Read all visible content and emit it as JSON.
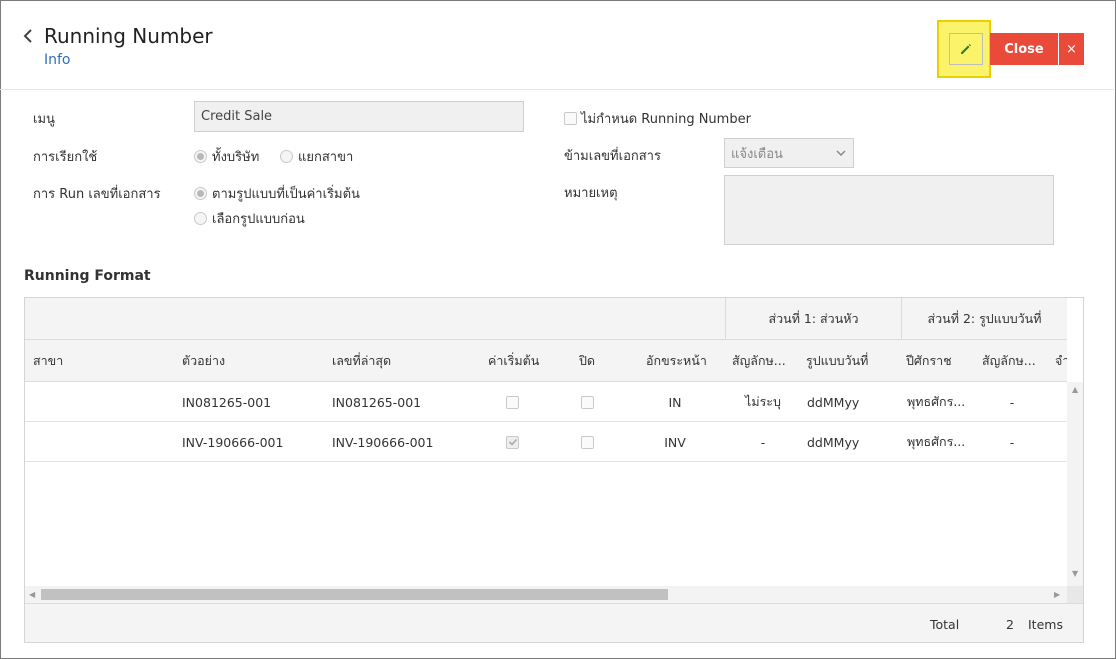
{
  "header": {
    "title": "Running Number",
    "subtitle": "Info",
    "close_label": "Close",
    "close_x": "×"
  },
  "form": {
    "menu_label": "เมนู",
    "menu_value": "Credit Sale",
    "usage_label": "การเรียกใช้",
    "usage_options": [
      "ทั้งบริษัท",
      "แยกสาขา"
    ],
    "run_label": "การ Run เลขที่เอกสาร",
    "run_options": [
      "ตามรูปแบบที่เป็นค่าเริ่มต้น",
      "เลือกรูปแบบก่อน"
    ],
    "no_running_label": "ไม่กำหนด Running Number",
    "skip_label": "ข้ามเลขที่เอกสาร",
    "skip_value": "แจ้งเตือน",
    "remark_label": "หมายเหตุ"
  },
  "section": {
    "title": "Running Format"
  },
  "grid": {
    "groups": [
      "ส่วนที่ 1: ส่วนหัว",
      "ส่วนที่ 2: รูปแบบวันที่"
    ],
    "columns": [
      "สาขา",
      "ตัวอย่าง",
      "เลขที่ล่าสุด",
      "ค่าเริ่มต้น",
      "ปิด",
      "อักขระหน้า",
      "สัญลักษ...",
      "รูปแบบวันที่",
      "ปีศักราช",
      "สัญลักษ...",
      "จำ"
    ],
    "rows": [
      {
        "branch": "",
        "example": "IN081265-001",
        "latest": "IN081265-001",
        "default": false,
        "closed": false,
        "prefix": "IN",
        "symbol1": "ไม่ระบุ",
        "date_format": "ddMMyy",
        "era": "พุทธศักร...",
        "symbol2": "-"
      },
      {
        "branch": "",
        "example": "INV-190666-001",
        "latest": "INV-190666-001",
        "default": true,
        "closed": false,
        "prefix": "INV",
        "symbol1": "-",
        "date_format": "ddMMyy",
        "era": "พุทธศักร...",
        "symbol2": "-"
      }
    ],
    "footer": {
      "total_label": "Total",
      "count": "2",
      "items_label": "Items"
    }
  }
}
